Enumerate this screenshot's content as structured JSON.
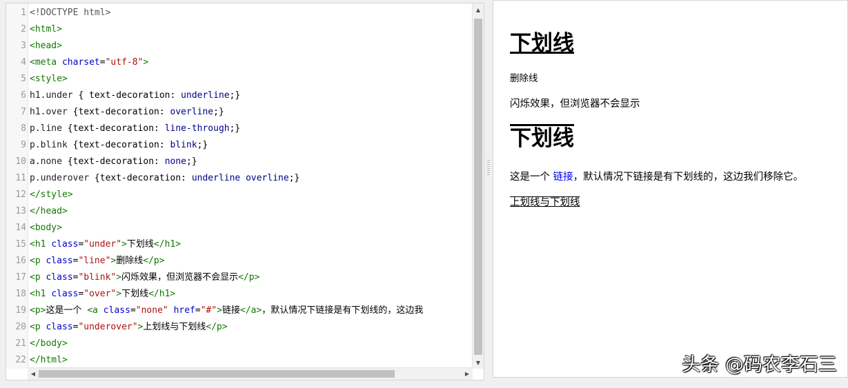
{
  "editor": {
    "line_numbers": [
      "1",
      "2",
      "3",
      "4",
      "5",
      "6",
      "7",
      "8",
      "9",
      "10",
      "11",
      "12",
      "13",
      "14",
      "15",
      "16",
      "17",
      "18",
      "19",
      "20",
      "21",
      "22"
    ],
    "lines": [
      [
        {
          "t": "<!DOCTYPE html>",
          "c": "dim"
        }
      ],
      [
        {
          "t": "<html>",
          "c": "tag"
        }
      ],
      [
        {
          "t": "<head>",
          "c": "tag"
        }
      ],
      [
        {
          "t": "<meta ",
          "c": "tag"
        },
        {
          "t": "charset",
          "c": "attr"
        },
        {
          "t": "=",
          "c": "txt"
        },
        {
          "t": "\"utf-8\"",
          "c": "str"
        },
        {
          "t": ">",
          "c": "tag"
        }
      ],
      [
        {
          "t": "<style>",
          "c": "tag"
        }
      ],
      [
        {
          "t": "h1.under ",
          "c": "sel"
        },
        {
          "t": "{ text-decoration: ",
          "c": "txt"
        },
        {
          "t": "underline",
          "c": "kw"
        },
        {
          "t": ";}",
          "c": "txt"
        }
      ],
      [
        {
          "t": "h1.over ",
          "c": "sel"
        },
        {
          "t": "{text-decoration: ",
          "c": "txt"
        },
        {
          "t": "overline",
          "c": "kw"
        },
        {
          "t": ";}",
          "c": "txt"
        }
      ],
      [
        {
          "t": "p.line ",
          "c": "sel"
        },
        {
          "t": "{text-decoration: ",
          "c": "txt"
        },
        {
          "t": "line-through",
          "c": "kw"
        },
        {
          "t": ";}",
          "c": "txt"
        }
      ],
      [
        {
          "t": "p.blink ",
          "c": "sel"
        },
        {
          "t": "{text-decoration: ",
          "c": "txt"
        },
        {
          "t": "blink",
          "c": "kw"
        },
        {
          "t": ";}",
          "c": "txt"
        }
      ],
      [
        {
          "t": "a.none ",
          "c": "sel"
        },
        {
          "t": "{text-decoration: ",
          "c": "txt"
        },
        {
          "t": "none",
          "c": "kw"
        },
        {
          "t": ";}",
          "c": "txt"
        }
      ],
      [
        {
          "t": "p.underover ",
          "c": "sel"
        },
        {
          "t": "{text-decoration: ",
          "c": "txt"
        },
        {
          "t": "underline overline",
          "c": "kw"
        },
        {
          "t": ";}",
          "c": "txt"
        }
      ],
      [
        {
          "t": "</style>",
          "c": "tag"
        }
      ],
      [
        {
          "t": "</head>",
          "c": "tag"
        }
      ],
      [
        {
          "t": "<body>",
          "c": "tag"
        }
      ],
      [
        {
          "t": "<h1 ",
          "c": "tag"
        },
        {
          "t": "class",
          "c": "attr"
        },
        {
          "t": "=",
          "c": "txt"
        },
        {
          "t": "\"under\"",
          "c": "str"
        },
        {
          "t": ">",
          "c": "tag"
        },
        {
          "t": "下划线",
          "c": "txt"
        },
        {
          "t": "</h1>",
          "c": "tag"
        }
      ],
      [
        {
          "t": "<p ",
          "c": "tag"
        },
        {
          "t": "class",
          "c": "attr"
        },
        {
          "t": "=",
          "c": "txt"
        },
        {
          "t": "\"line\"",
          "c": "str"
        },
        {
          "t": ">",
          "c": "tag"
        },
        {
          "t": "删除线",
          "c": "txt"
        },
        {
          "t": "</p>",
          "c": "tag"
        }
      ],
      [
        {
          "t": "<p ",
          "c": "tag"
        },
        {
          "t": "class",
          "c": "attr"
        },
        {
          "t": "=",
          "c": "txt"
        },
        {
          "t": "\"blink\"",
          "c": "str"
        },
        {
          "t": ">",
          "c": "tag"
        },
        {
          "t": "闪烁效果，但浏览器不会显示",
          "c": "txt"
        },
        {
          "t": "</p>",
          "c": "tag"
        }
      ],
      [
        {
          "t": "<h1 ",
          "c": "tag"
        },
        {
          "t": "class",
          "c": "attr"
        },
        {
          "t": "=",
          "c": "txt"
        },
        {
          "t": "\"over\"",
          "c": "str"
        },
        {
          "t": ">",
          "c": "tag"
        },
        {
          "t": "下划线",
          "c": "txt"
        },
        {
          "t": "</h1>",
          "c": "tag"
        }
      ],
      [
        {
          "t": "<p>",
          "c": "tag"
        },
        {
          "t": "这是一个 ",
          "c": "txt"
        },
        {
          "t": "<a ",
          "c": "tag"
        },
        {
          "t": "class",
          "c": "attr"
        },
        {
          "t": "=",
          "c": "txt"
        },
        {
          "t": "\"none\" ",
          "c": "str"
        },
        {
          "t": "href",
          "c": "attr"
        },
        {
          "t": "=",
          "c": "txt"
        },
        {
          "t": "\"#\"",
          "c": "str"
        },
        {
          "t": ">",
          "c": "tag"
        },
        {
          "t": "链接",
          "c": "txt"
        },
        {
          "t": "</a>",
          "c": "tag"
        },
        {
          "t": "，默认情况下链接是有下划线的，这边我",
          "c": "txt"
        }
      ],
      [
        {
          "t": "<p ",
          "c": "tag"
        },
        {
          "t": "class",
          "c": "attr"
        },
        {
          "t": "=",
          "c": "txt"
        },
        {
          "t": "\"underover\"",
          "c": "str"
        },
        {
          "t": ">",
          "c": "tag"
        },
        {
          "t": "上划线与下划线",
          "c": "txt"
        },
        {
          "t": "</p>",
          "c": "tag"
        }
      ],
      [
        {
          "t": "</body>",
          "c": "tag"
        }
      ],
      [
        {
          "t": "</html>",
          "c": "tag"
        }
      ]
    ]
  },
  "preview": {
    "h1_under": "下划线",
    "p_line": "删除线",
    "p_blink": "闪烁效果，但浏览器不会显示",
    "h1_over": "下划线",
    "p_text_before": "这是一个 ",
    "link_text": "链接",
    "p_text_after": "，默认情况下链接是有下划线的，这边我们移除它。",
    "p_underover": "上划线与下划线"
  },
  "watermark": "头条 @码农李石三"
}
